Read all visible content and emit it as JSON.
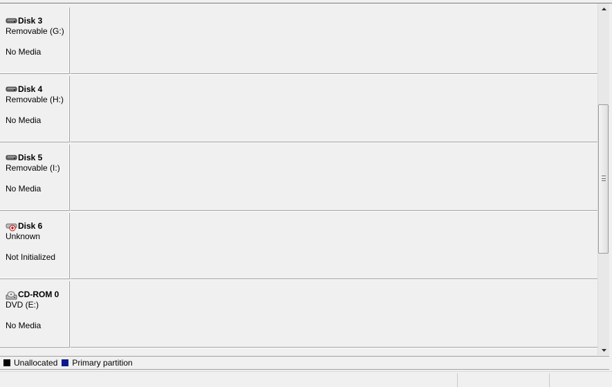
{
  "disks": [
    {
      "name": "Disk 3",
      "type": "Removable (G:)",
      "status": "No Media",
      "icon": "removable-disk-icon"
    },
    {
      "name": "Disk 4",
      "type": "Removable (H:)",
      "status": "No Media",
      "icon": "removable-disk-icon"
    },
    {
      "name": "Disk 5",
      "type": "Removable (I:)",
      "status": "No Media",
      "icon": "removable-disk-icon"
    },
    {
      "name": "Disk 6",
      "type": "Unknown",
      "status": "Not Initialized",
      "icon": "uninitialized-disk-icon"
    },
    {
      "name": "CD-ROM 0",
      "type": "DVD (E:)",
      "status": "No Media",
      "icon": "cdrom-icon"
    }
  ],
  "legend": {
    "items": [
      {
        "label": "Unallocated",
        "color": "#000000"
      },
      {
        "label": "Primary partition",
        "color": "#0a1a8c"
      }
    ]
  },
  "scrollbar": {
    "position": 0.55
  },
  "colors": {
    "background": "#f0f0f0",
    "border": "#a0a0a0",
    "unallocated": "#000000",
    "primary_partition": "#0a1a8c",
    "error_badge": "#c00000"
  }
}
